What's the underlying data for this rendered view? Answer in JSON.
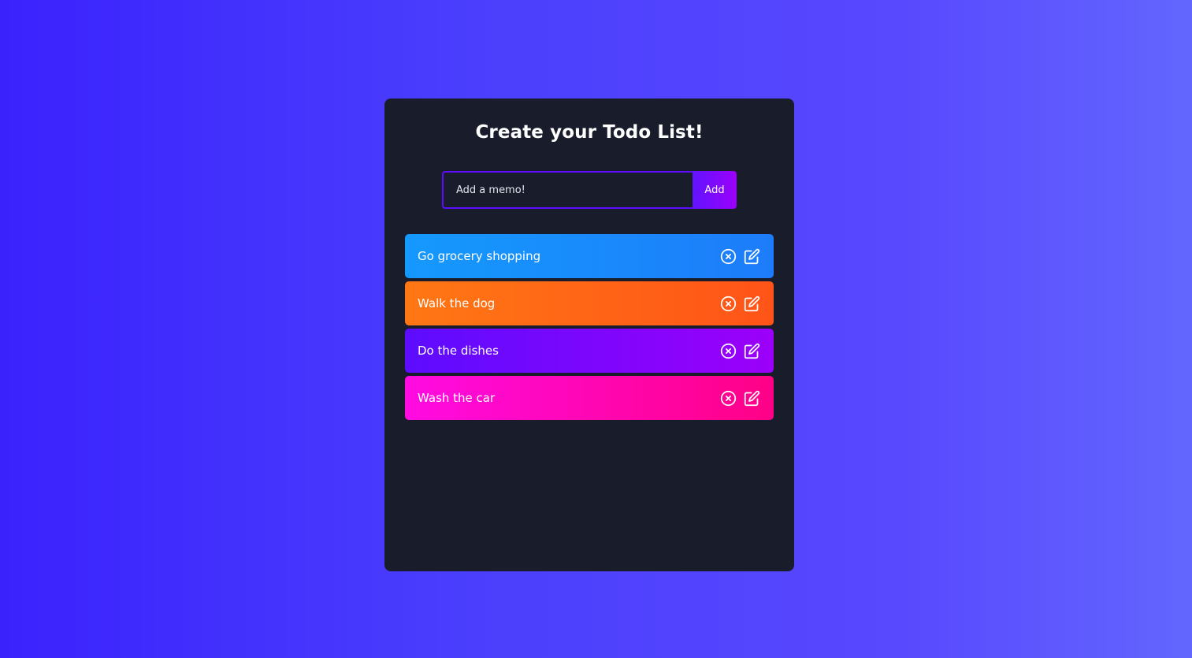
{
  "app": {
    "title": "Create your Todo List!"
  },
  "form": {
    "placeholder": "Add a memo!",
    "add_label": "Add"
  },
  "todos": [
    {
      "text": "Go grocery shopping",
      "color_from": "#1599fd",
      "color_to": "#1d7cfa"
    },
    {
      "text": "Walk the dog",
      "color_from": "#ff7714",
      "color_to": "#ff5418"
    },
    {
      "text": "Do the dishes",
      "color_from": "#5d0cff",
      "color_to": "#9b00fa"
    },
    {
      "text": "Wash the car",
      "color_from": "#ff0be2",
      "color_to": "#ff0186"
    }
  ],
  "icons": {
    "delete": "close-circle-icon",
    "edit": "edit-icon"
  },
  "colors": {
    "page_gradient_start": "#3a22fd",
    "page_gradient_end": "#6366fe",
    "card_background": "#191d2b",
    "accent": "#5d0cff"
  }
}
